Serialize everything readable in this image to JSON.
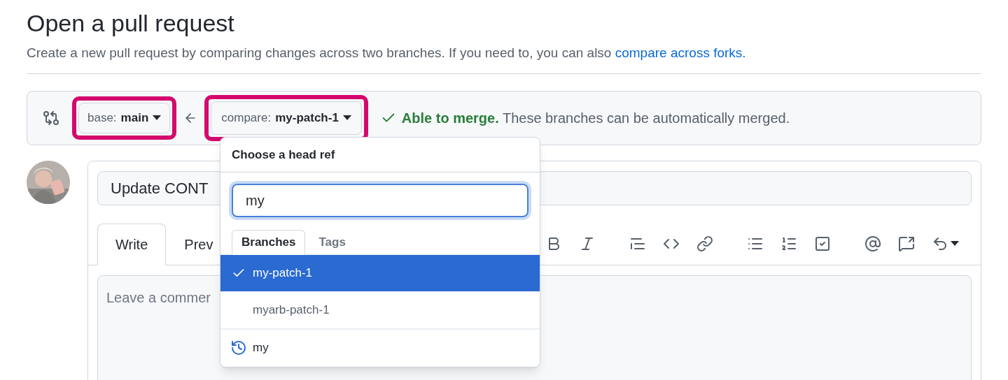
{
  "header": {
    "title": "Open a pull request",
    "description": "Create a new pull request by comparing changes across two branches. If you need to, you can also ",
    "link": "compare across forks."
  },
  "compare_bar": {
    "base": {
      "label": "base:",
      "branch": "main",
      "highlighted": true
    },
    "compare": {
      "label": "compare:",
      "branch": "my-patch-1",
      "highlighted": true
    },
    "status": {
      "kind": "success",
      "strong": "Able to merge.",
      "text": "These branches can be automatically merged."
    }
  },
  "pr_form": {
    "title_value": "Update CONT",
    "tabs": [
      {
        "label": "Write",
        "selected": true
      },
      {
        "label": "Prev",
        "selected": false
      }
    ],
    "comment_placeholder": "Leave a commer"
  },
  "branch_menu": {
    "title": "Choose a head ref",
    "filter_value": "my",
    "tabs": [
      {
        "label": "Branches",
        "selected": true
      },
      {
        "label": "Tags",
        "selected": false
      }
    ],
    "items": [
      {
        "label": "my-patch-1",
        "selected": true
      },
      {
        "label": "myarb-patch-1",
        "selected": false
      }
    ],
    "history": {
      "label": "my"
    }
  }
}
